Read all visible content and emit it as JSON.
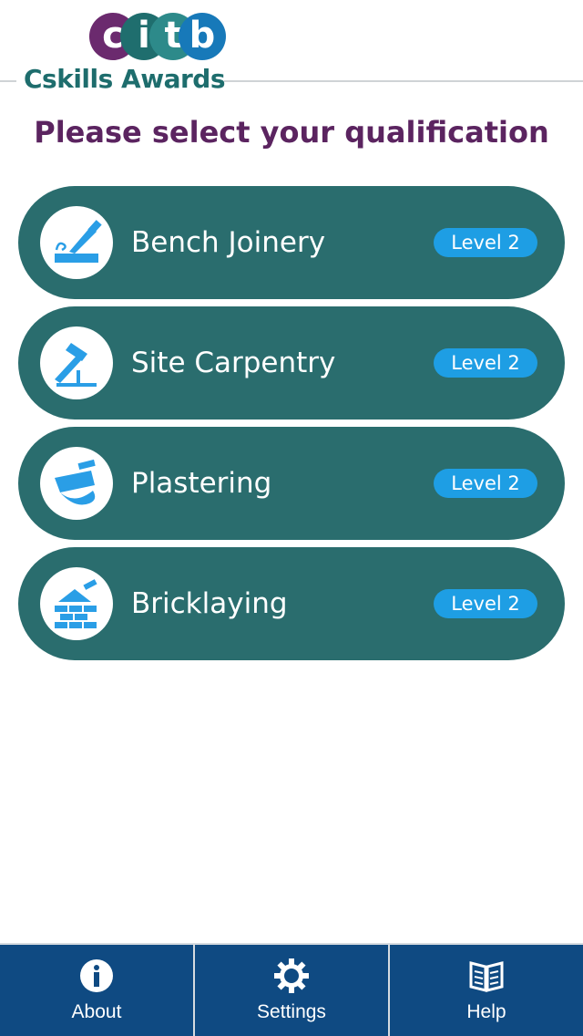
{
  "logo": {
    "letters": [
      "c",
      "i",
      "t",
      "b"
    ],
    "subtitle": "Cskills Awards"
  },
  "page_title": "Please select your qualification",
  "qualifications": [
    {
      "label": "Bench Joinery",
      "level": "Level 2",
      "icon": "chisel-icon"
    },
    {
      "label": "Site Carpentry",
      "level": "Level 2",
      "icon": "hammer-icon"
    },
    {
      "label": "Plastering",
      "level": "Level 2",
      "icon": "plastering-trowel-icon"
    },
    {
      "label": "Bricklaying",
      "level": "Level 2",
      "icon": "brick-wall-icon"
    }
  ],
  "tabbar": {
    "about": {
      "label": "About",
      "icon": "info-icon"
    },
    "settings": {
      "label": "Settings",
      "icon": "gear-icon"
    },
    "help": {
      "label": "Help",
      "icon": "book-icon"
    }
  },
  "colors": {
    "item_bg": "#2a6d6e",
    "badge_bg": "#1e9ee4",
    "title": "#5b2460",
    "tabbar_bg": "#0f4a82",
    "icon_blue": "#2a9ee6"
  }
}
